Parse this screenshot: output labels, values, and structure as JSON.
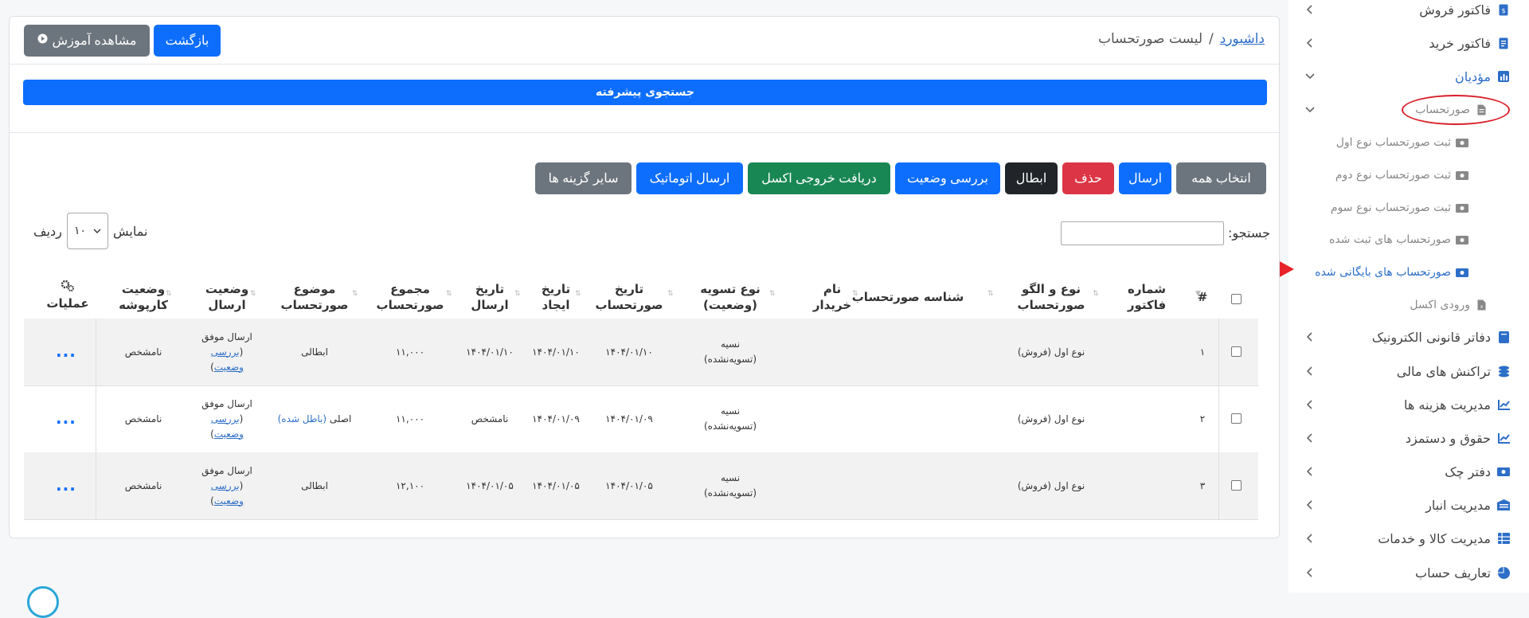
{
  "sidebar": {
    "items": [
      {
        "label": "فاکتور فروش",
        "icon": "invoice-icon"
      },
      {
        "label": "فاکتور خرید",
        "icon": "invoice-icon"
      },
      {
        "label": "مؤدیان",
        "icon": "chart-icon"
      },
      {
        "label": "صورتحساب",
        "icon": "document-icon"
      },
      {
        "label": "ثبت صورتحساب نوع اول",
        "icon": "money-icon"
      },
      {
        "label": "ثبت صورتحساب نوع دوم",
        "icon": "money-icon"
      },
      {
        "label": "ثبت صورتحساب نوع سوم",
        "icon": "money-icon"
      },
      {
        "label": "صورتحساب های ثبت شده",
        "icon": "money-icon"
      },
      {
        "label": "صورتحساب های بایگانی شده",
        "icon": "money-icon"
      },
      {
        "label": "ورودی اکسل",
        "icon": "excel-icon"
      },
      {
        "label": "دفاتر قانونی الکترونیک",
        "icon": "book-icon"
      },
      {
        "label": "تراکنش های مالی",
        "icon": "coins-icon"
      },
      {
        "label": "مدیریت هزینه ها",
        "icon": "chart-line-icon"
      },
      {
        "label": "حقوق و دستمزد",
        "icon": "chart-line-icon"
      },
      {
        "label": "دفتر چک",
        "icon": "check-icon"
      },
      {
        "label": "مدیریت انبار",
        "icon": "warehouse-icon"
      },
      {
        "label": "مدیریت کالا و خدمات",
        "icon": "grid-icon"
      },
      {
        "label": "تعاریف حساب",
        "icon": "pie-icon"
      }
    ],
    "accent": "#2d6ec8"
  },
  "breadcrumb": {
    "home": "داشبورد",
    "separator": "/",
    "current": "لیست صورتحساب"
  },
  "header_buttons": {
    "back": "بازگشت",
    "tutorial": "مشاهده آموزش"
  },
  "advanced_search": "جستجوی پیشرفته",
  "toolbar": {
    "select_all": "انتخاب همه",
    "send": "ارسال",
    "delete": "حذف",
    "cancel": "ابطال",
    "check_status": "بررسی وضعیت",
    "excel_export": "دریافت خروجی اکسل",
    "auto_send": "ارسال اتوماتیک",
    "other_options": "سایر گزینه ها"
  },
  "search": {
    "label": "جستجو:",
    "value": ""
  },
  "length": {
    "show": "نمایش",
    "value": "۱۰",
    "rows": "ردیف"
  },
  "table": {
    "headers": {
      "num": "#",
      "invoice_no": [
        "شماره",
        "فاکتور"
      ],
      "type": [
        "نوع و الگو",
        "صورتحساب"
      ],
      "id": [
        "شناسه صورتحساب"
      ],
      "buyer": [
        "نام",
        "خریدار"
      ],
      "settlement": [
        "نوع تسویه",
        "(وضعیت)"
      ],
      "invoice_date": [
        "تاریخ",
        "صورتحساب"
      ],
      "created": [
        "تاریخ",
        "ایجاد"
      ],
      "sent": [
        "تاریخ",
        "ارسال"
      ],
      "total": [
        "مجموع",
        "صورتحساب"
      ],
      "subject": [
        "موضوع",
        "صورتحساب"
      ],
      "send_status": [
        "وضعیت",
        "ارسال"
      ],
      "folder_status": [
        "وضعیت",
        "کارپوشه"
      ],
      "operations": "عملیات"
    },
    "rows": [
      {
        "num": "۱",
        "type": "نوع اول (فروش)",
        "settle1": "نسیه",
        "settle2": "(تسویه‌نشده)",
        "invoice_date": "۱۴۰۴/۰۱/۱۰",
        "created": "۱۴۰۴/۰۱/۱۰",
        "sent": "۱۴۰۴/۰۱/۱۰",
        "total": "۱۱,۰۰۰",
        "subject": "ابطالی",
        "subject_extra": "",
        "status1": "ارسال موفق",
        "status_link1": "بررسی",
        "status_link2": "وضعیت",
        "folder": "نامشخص"
      },
      {
        "num": "۲",
        "type": "نوع اول (فروش)",
        "settle1": "نسیه",
        "settle2": "(تسویه‌نشده)",
        "invoice_date": "۱۴۰۴/۰۱/۰۹",
        "created": "۱۴۰۴/۰۱/۰۹",
        "sent": "نامشخص",
        "total": "۱۱,۰۰۰",
        "subject": "اصلی",
        "subject_extra": "(باطل شده)",
        "status1": "ارسال موفق",
        "status_link1": "بررسی",
        "status_link2": "وضعیت",
        "folder": "نامشخص"
      },
      {
        "num": "۳",
        "type": "نوع اول (فروش)",
        "settle1": "نسیه",
        "settle2": "(تسویه‌نشده)",
        "invoice_date": "۱۴۰۴/۰۱/۰۵",
        "created": "۱۴۰۴/۰۱/۰۵",
        "sent": "۱۴۰۴/۰۱/۰۵",
        "total": "۱۲,۱۰۰",
        "subject": "ابطالی",
        "subject_extra": "",
        "status1": "ارسال موفق",
        "status_link1": "بررسی",
        "status_link2": "وضعیت",
        "folder": "نامشخص"
      }
    ],
    "more": "..."
  }
}
